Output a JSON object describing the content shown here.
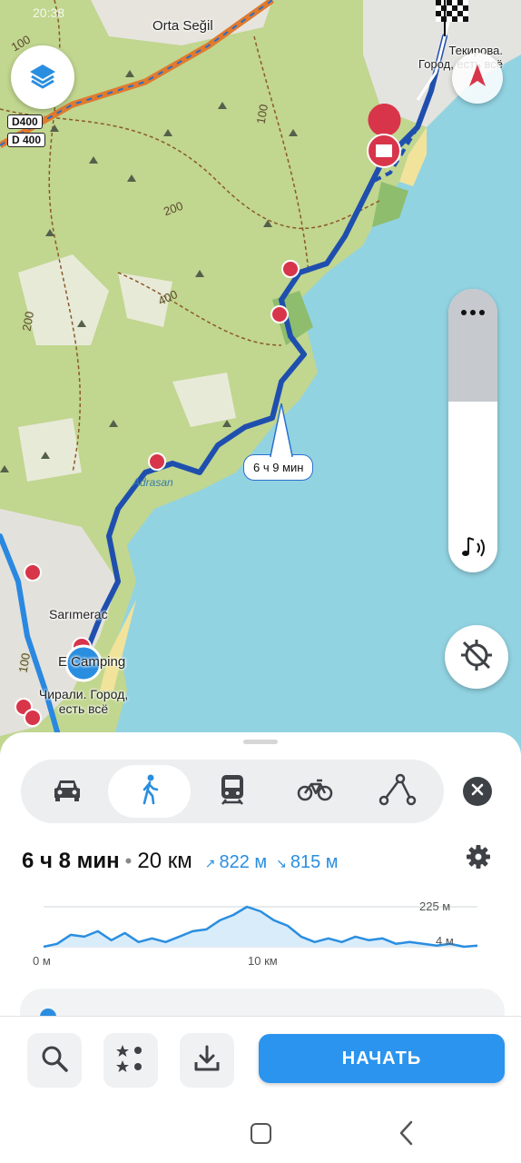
{
  "status_bar": {
    "time": "20:38"
  },
  "map": {
    "places": [
      {
        "name": "Orta Seğil"
      },
      {
        "name": "Текирова. Город, есть всё",
        "line1": "Текирова.",
        "line2": "Город, есть всё"
      },
      {
        "name": "Sarımerac"
      },
      {
        "name": "E Camping"
      },
      {
        "name": "Чирали. Город, есть всё",
        "line1": "Чирали. Город,",
        "line2": "есть всё"
      },
      {
        "name": "Adrasan"
      }
    ],
    "road_labels": [
      "D400",
      "D 400"
    ],
    "contour_labels": [
      "100",
      "200",
      "400",
      "200",
      "100",
      "100"
    ],
    "duration_bubble": "6 ч 9 мин",
    "icons": [
      "layers-icon",
      "compass-icon",
      "menu-dots-icon",
      "sound-icon",
      "gps-off-icon"
    ],
    "colors": {
      "sea": "#92d3e2",
      "land": "#c1d68f",
      "route": "#2155b5",
      "accent": "#2b94ee"
    }
  },
  "sheet": {
    "modes": [
      {
        "name": "car",
        "icon": "car-icon",
        "active": false
      },
      {
        "name": "walk",
        "icon": "walk-icon",
        "active": true
      },
      {
        "name": "transit",
        "icon": "train-icon",
        "active": false
      },
      {
        "name": "bike",
        "icon": "bike-icon",
        "active": false
      },
      {
        "name": "ruler",
        "icon": "ruler-route-icon",
        "active": false
      }
    ],
    "duration": "6 ч 8 мин",
    "separator": "•",
    "distance": "20 км",
    "ascent": "822 м",
    "descent": "815 м",
    "ascent_arrow": "↗",
    "descent_arrow": "↘",
    "profile": {
      "max_label": "225 м",
      "min_label": "4 м",
      "x_start": "0 м",
      "x_mid": "10 км",
      "elevations": [
        4,
        20,
        70,
        60,
        90,
        40,
        80,
        30,
        50,
        30,
        60,
        90,
        100,
        150,
        180,
        225,
        200,
        150,
        120,
        60,
        30,
        50,
        30,
        60,
        40,
        50,
        20,
        30,
        20,
        10,
        20,
        4,
        10
      ]
    }
  },
  "toolbar": {
    "search_icon": "search-icon",
    "favorites_icon": "stars-icon",
    "download_icon": "download-icon",
    "start_label": "НАЧАТЬ"
  }
}
